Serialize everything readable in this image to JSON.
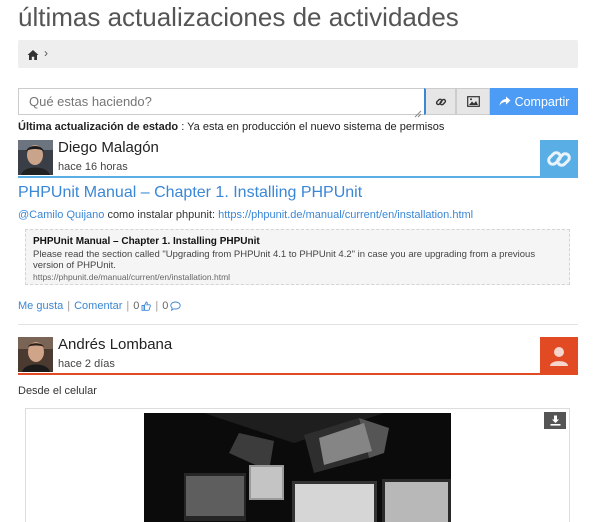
{
  "page": {
    "title": "últimas actualizaciones de actividades"
  },
  "breadcrumb": {
    "home_icon": "home-icon",
    "separator": "›"
  },
  "composer": {
    "placeholder": "Qué estas haciendo?",
    "link_icon": "link-icon",
    "image_icon": "image-icon",
    "share_label": "Compartir",
    "share_icon": "share-icon",
    "share_color": "#4c9bf5"
  },
  "last_status": {
    "label": "Última actualización de estado",
    "separator": " : ",
    "text": "Ya esta en producción el nuevo sistema de permisos"
  },
  "posts": [
    {
      "author": "Diego Malagón",
      "time": "hace 16 horas",
      "type_icon": "link-icon",
      "accent": "#5aaee6",
      "link_title": "PHPUnit Manual – Chapter 1. Installing PHPUnit",
      "mention": "@Camilo Quijano",
      "text_between": "como instalar phpunit:",
      "url": "https://phpunit.de/manual/current/en/installation.html",
      "preview": {
        "title": "PHPUnit Manual – Chapter 1. Installing PHPUnit",
        "text": "Please read the section called \"Upgrading from PHPUnit 4.1 to PHPUnit 4.2\" in case you are upgrading from a previous version of PHPUnit.",
        "url": "https://phpunit.de/manual/current/en/installation.html"
      },
      "actions": {
        "like": "Me gusta",
        "comment": "Comentar",
        "like_count": "0",
        "comment_count": "0",
        "separator": "|"
      }
    },
    {
      "author": "Andrés Lombana",
      "time": "hace 2 días",
      "type_icon": "user-icon",
      "accent": "#e24a24",
      "text": "Desde el celular",
      "download_icon": "download-icon"
    }
  ]
}
